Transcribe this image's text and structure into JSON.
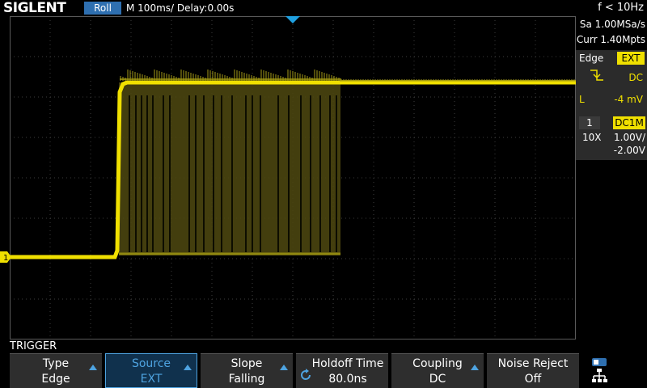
{
  "header": {
    "brand": "SIGLENT",
    "mode": "Roll",
    "timebase": "M 100ms/  Delay:0.00s",
    "frequency": "f < 10Hz"
  },
  "acquisition": {
    "sample_rate": "Sa 1.00MSa/s",
    "memory_depth": "Curr 1.40Mpts"
  },
  "trigger_info": {
    "type": "Edge",
    "source": "EXT",
    "coupling": "DC",
    "level_label": "L",
    "level": "-4 mV"
  },
  "channel1": {
    "number": "1",
    "coupling": "DC1M",
    "probe": "10X",
    "scale": "1.00V/",
    "offset": "-2.00V",
    "marker": "1",
    "color": "#f0e000"
  },
  "menu": {
    "title": "TRIGGER",
    "softkeys": [
      {
        "top": "Type",
        "bottom": "Edge"
      },
      {
        "top": "Source",
        "bottom": "EXT"
      },
      {
        "top": "Slope",
        "bottom": "Falling"
      },
      {
        "top": "Holdoff Time",
        "bottom": "80.0ns"
      },
      {
        "top": "Coupling",
        "bottom": "DC"
      },
      {
        "top": "Noise Reject",
        "bottom": "Off"
      }
    ]
  },
  "colors": {
    "trace": "#f0e000",
    "accent": "#2e6fb0",
    "trigger_marker": "#1fa0e0"
  }
}
